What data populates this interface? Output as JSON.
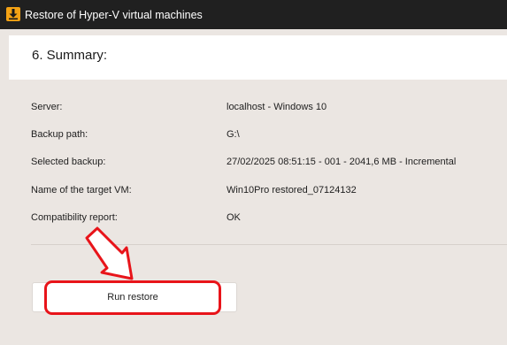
{
  "window": {
    "title": "Restore of Hyper-V virtual machines",
    "app_icon": "download-arrow-icon",
    "icon_color": "#f4a214"
  },
  "step": {
    "title": "6. Summary:"
  },
  "summary": {
    "rows": [
      {
        "label": "Server:",
        "value": "localhost - Windows 10"
      },
      {
        "label": "Backup path:",
        "value": "G:\\"
      },
      {
        "label": "Selected backup:",
        "value": "27/02/2025 08:51:15 - 001 - 2041,6 MB - Incremental"
      },
      {
        "label": "Name of the target VM:",
        "value": "Win10Pro restored_07124132"
      },
      {
        "label": "Compatibility report:",
        "value": "OK"
      }
    ]
  },
  "actions": {
    "run_restore_label": "Run restore"
  },
  "colors": {
    "titlebar": "#202020",
    "background": "#ebe6e2",
    "highlight": "#e8141a"
  }
}
